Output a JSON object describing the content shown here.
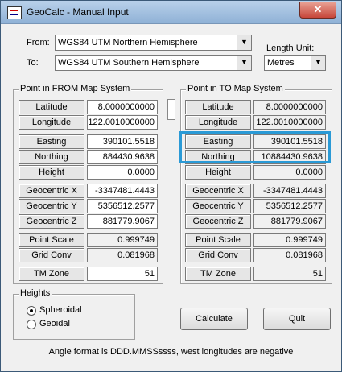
{
  "window": {
    "title": "GeoCalc - Manual Input",
    "close_label": "✕"
  },
  "from": {
    "label": "From:",
    "value": "WGS84 UTM Northern Hemisphere"
  },
  "to": {
    "label": "To:",
    "value": "WGS84 UTM Southern Hemisphere"
  },
  "length_unit": {
    "label": "Length Unit:",
    "value": "Metres"
  },
  "from_group": {
    "title": "Point in FROM Map System",
    "latitude": {
      "label": "Latitude",
      "value": "8.0000000000"
    },
    "longitude": {
      "label": "Longitude",
      "value": "122.0010000000"
    },
    "easting": {
      "label": "Easting",
      "value": "390101.5518"
    },
    "northing": {
      "label": "Northing",
      "value": "884430.9638"
    },
    "height": {
      "label": "Height",
      "value": "0.0000"
    },
    "geo_x": {
      "label": "Geocentric X",
      "value": "-3347481.4443"
    },
    "geo_y": {
      "label": "Geocentric Y",
      "value": "5356512.2577"
    },
    "geo_z": {
      "label": "Geocentric Z",
      "value": "881779.9067"
    },
    "point_scale": {
      "label": "Point Scale",
      "value": "0.999749"
    },
    "grid_conv": {
      "label": "Grid Conv",
      "value": "0.081968"
    },
    "tm_zone": {
      "label": "TM Zone",
      "value": "51"
    }
  },
  "to_group": {
    "title": "Point in TO Map System",
    "latitude": {
      "label": "Latitude",
      "value": "8.0000000000"
    },
    "longitude": {
      "label": "Longitude",
      "value": "122.0010000000"
    },
    "easting": {
      "label": "Easting",
      "value": "390101.5518"
    },
    "northing": {
      "label": "Northing",
      "value": "10884430.9638"
    },
    "height": {
      "label": "Height",
      "value": "0.0000"
    },
    "geo_x": {
      "label": "Geocentric X",
      "value": "-3347481.4443"
    },
    "geo_y": {
      "label": "Geocentric Y",
      "value": "5356512.2577"
    },
    "geo_z": {
      "label": "Geocentric Z",
      "value": "881779.9067"
    },
    "point_scale": {
      "label": "Point Scale",
      "value": "0.999749"
    },
    "grid_conv": {
      "label": "Grid Conv",
      "value": "0.081968"
    },
    "tm_zone": {
      "label": "TM Zone",
      "value": "51"
    }
  },
  "heights": {
    "title": "Heights",
    "spheroidal": "Spheroidal",
    "geoidal": "Geoidal",
    "selected": "Spheroidal"
  },
  "buttons": {
    "calculate": "Calculate",
    "quit": "Quit"
  },
  "status": "Angle format is DDD.MMSSssss, west longitudes are negative",
  "colors": {
    "highlight": "#2a9ad6"
  }
}
